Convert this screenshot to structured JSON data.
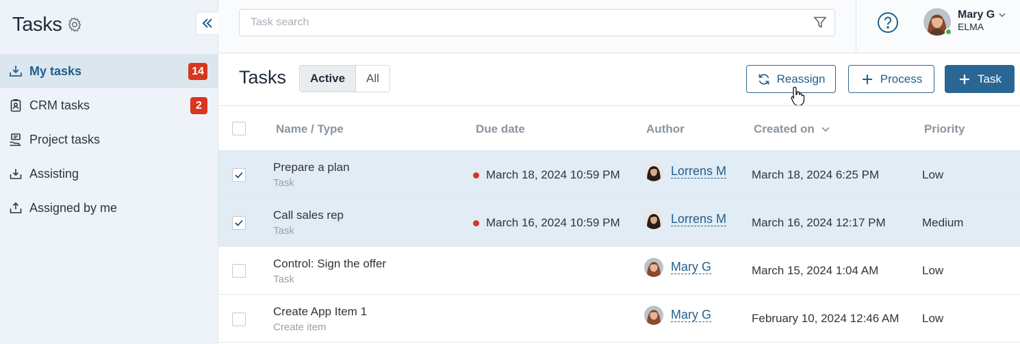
{
  "sidebar": {
    "title": "Tasks",
    "items": [
      {
        "label": "My tasks",
        "badge": "14",
        "icon": "inbox-download-icon"
      },
      {
        "label": "CRM tasks",
        "badge": "2",
        "icon": "clipboard-badge-icon"
      },
      {
        "label": "Project tasks",
        "badge": "",
        "icon": "hand-project-icon"
      },
      {
        "label": "Assisting",
        "badge": "",
        "icon": "tray-in-icon"
      },
      {
        "label": "Assigned by me",
        "badge": "",
        "icon": "tray-out-icon"
      }
    ]
  },
  "topbar": {
    "search_placeholder": "Task search",
    "user": {
      "name": "Mary G",
      "org": "ELMA"
    }
  },
  "toolbar": {
    "title": "Tasks",
    "filters": [
      "Active",
      "All"
    ],
    "reassign_label": "Reassign",
    "process_label": "Process",
    "task_label": "Task"
  },
  "table": {
    "columns": [
      "Name / Type",
      "Due date",
      "Author",
      "Created on",
      "Priority"
    ],
    "rows": [
      {
        "name": "Prepare a plan",
        "type": "Task",
        "due": "March 18, 2024 10:59 PM",
        "author": "Lorrens M",
        "created": "March 18, 2024 6:25 PM",
        "priority": "Low",
        "checked": true
      },
      {
        "name": "Call sales rep",
        "type": "Task",
        "due": "March 16, 2024 10:59 PM",
        "author": "Lorrens M",
        "created": "March 16, 2024 12:17 PM",
        "priority": "Medium",
        "checked": true
      },
      {
        "name": "Control: Sign the offer",
        "type": "Task",
        "due": "",
        "author": "Mary G",
        "created": "March 15, 2024 1:04 AM",
        "priority": "Low",
        "checked": false
      },
      {
        "name": "Create App Item 1",
        "type": "Create item",
        "due": "",
        "author": "Mary G",
        "created": "February 10, 2024 12:46 AM",
        "priority": "Low",
        "checked": false
      }
    ]
  },
  "colors": {
    "accent": "#2a6694",
    "badge": "#d9361e",
    "sidebar_bg": "#edf3f8",
    "selected_row": "#e1ecf5"
  }
}
